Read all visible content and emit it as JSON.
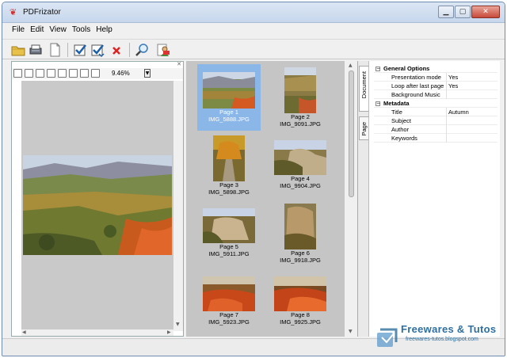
{
  "window": {
    "title": "PDFrizator",
    "app_icon": "pdfrizator-app-icon",
    "controls": [
      "minimize-icon",
      "maximize-icon",
      "close-icon"
    ]
  },
  "menu": {
    "items": [
      "File",
      "Edit",
      "View",
      "Tools",
      "Help"
    ]
  },
  "toolbar": {
    "buttons": [
      "open-folder-icon",
      "scan-import-icon",
      "new-page-icon",
      "check-icon",
      "check-list-icon",
      "delete-icon",
      "search-zoom-icon",
      "user-pdf-icon"
    ]
  },
  "preview": {
    "zoom": "9.46%",
    "tools": [
      "hand-icon",
      "rotate-icon",
      "fit-page-icon",
      "fit-width-icon",
      "page-view-icon",
      "two-page-icon",
      "book-icon",
      "page-flip-icon"
    ]
  },
  "thumbnails": [
    {
      "page": "Page 1",
      "file": "IMG_5888.JPG",
      "selected": true
    },
    {
      "page": "Page 2",
      "file": "IMG_9091.JPG",
      "selected": false
    },
    {
      "page": "Page 3",
      "file": "IMG_5898.JPG",
      "selected": false
    },
    {
      "page": "Page 4",
      "file": "IMG_9904.JPG",
      "selected": false
    },
    {
      "page": "Page 5",
      "file": "IMG_5911.JPG",
      "selected": false
    },
    {
      "page": "Page 6",
      "file": "IMG_9918.JPG",
      "selected": false
    },
    {
      "page": "Page 7",
      "file": "IMG_5923.JPG",
      "selected": false
    },
    {
      "page": "Page 8",
      "file": "IMG_9925.JPG",
      "selected": false
    }
  ],
  "properties": {
    "tabs": [
      "Document",
      "Page"
    ],
    "general_options_label": "General Options",
    "general_options": [
      {
        "key": "Presentation mode",
        "value": "Yes"
      },
      {
        "key": "Loop after last page",
        "value": "Yes"
      },
      {
        "key": "Background Music",
        "value": ""
      }
    ],
    "metadata_label": "Metadata",
    "metadata": [
      {
        "key": "Title",
        "value": "Autumn"
      },
      {
        "key": "Subject",
        "value": ""
      },
      {
        "key": "Author",
        "value": ""
      },
      {
        "key": "Keywords",
        "value": ""
      }
    ]
  },
  "watermark": {
    "brand": "Freewares & Tutos",
    "url": "freewares-tutos.blogspot.com"
  }
}
